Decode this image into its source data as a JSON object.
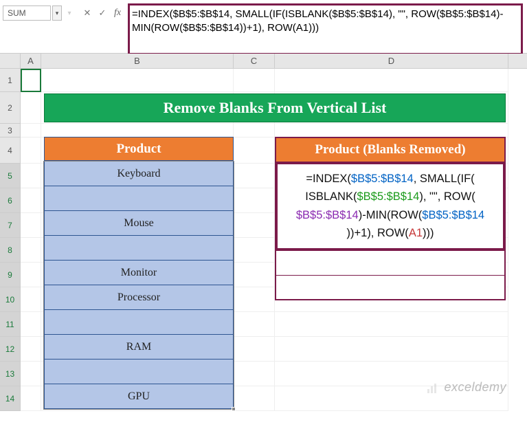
{
  "nameBox": "SUM",
  "formulaBar": "=INDEX($B$5:$B$14, SMALL(IF(ISBLANK($B$5:$B$14), \"\", ROW($B$5:$B$14)-MIN(ROW($B$5:$B$14))+1), ROW(A1)))",
  "columns": [
    "A",
    "B",
    "C",
    "D"
  ],
  "rows": [
    "1",
    "2",
    "3",
    "4",
    "5",
    "6",
    "7",
    "8",
    "9",
    "10",
    "11",
    "12",
    "13",
    "14"
  ],
  "title": "Remove Blanks From Vertical List",
  "tableLeft": {
    "header": "Product",
    "items": [
      "Keyboard",
      "",
      "Mouse",
      "",
      "Monitor",
      "Processor",
      "",
      "RAM",
      "",
      "GPU"
    ]
  },
  "tableRight": {
    "header": "Product (Blanks Removed)",
    "formulaParts": {
      "p1": "=INDEX(",
      "r1": "$B$5:$B$14",
      "p2": ", SMALL(IF(",
      "p3": "ISBLANK(",
      "r2": "$B$5:$B$14",
      "p4": "), \"\", ROW(",
      "r3": "$B$5:$B$14",
      "p5": ")-MIN(ROW(",
      "r4": "$B$5:$B$14",
      "p6": "))+1), ROW(",
      "ra": "A1",
      "p7": ")))"
    }
  },
  "watermark": "exceldemy",
  "fx": {
    "cancel": "✕",
    "confirm": "✓",
    "label": "fx"
  }
}
